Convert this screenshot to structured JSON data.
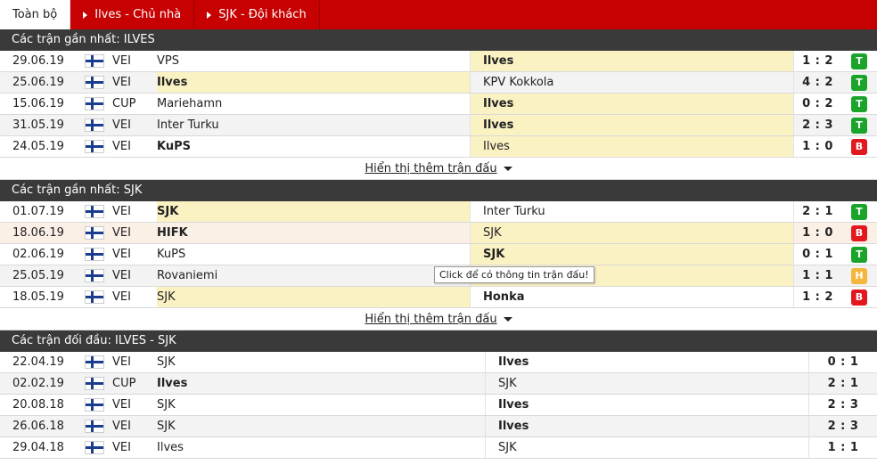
{
  "tabs": [
    {
      "label": "Toàn bộ",
      "active": true
    },
    {
      "label": "Ilves - Chủ nhà",
      "active": false
    },
    {
      "label": "SJK - Đội khách",
      "active": false
    }
  ],
  "sections": [
    {
      "title": "Các trận gần nhất: ILVES",
      "matches": [
        {
          "date": "29.06.19",
          "league": "VEI",
          "home": "VPS",
          "away": "Ilves",
          "score": "1 : 2",
          "result": "T",
          "hl": "away"
        },
        {
          "date": "25.06.19",
          "league": "VEI",
          "home": "Ilves",
          "away": "KPV Kokkola",
          "score": "4 : 2",
          "result": "T",
          "hl": "home"
        },
        {
          "date": "15.06.19",
          "league": "CUP",
          "home": "Mariehamn",
          "away": "Ilves",
          "score": "0 : 2",
          "result": "T",
          "hl": "away"
        },
        {
          "date": "31.05.19",
          "league": "VEI",
          "home": "Inter Turku",
          "away": "Ilves",
          "score": "2 : 3",
          "result": "T",
          "hl": "away"
        },
        {
          "date": "24.05.19",
          "league": "VEI",
          "home": "KuPS",
          "away": "Ilves",
          "score": "1 : 0",
          "result": "B",
          "hl": "away",
          "bold": "home"
        }
      ],
      "more": "Hiển thị thêm trận đấu"
    },
    {
      "title": "Các trận gần nhất: SJK",
      "matches": [
        {
          "date": "01.07.19",
          "league": "VEI",
          "home": "SJK",
          "away": "Inter Turku",
          "score": "2 : 1",
          "result": "T",
          "hl": "home"
        },
        {
          "date": "18.06.19",
          "league": "VEI",
          "home": "HIFK",
          "away": "SJK",
          "score": "1 : 0",
          "result": "B",
          "hl": "away",
          "bold": "home",
          "rowhl": true
        },
        {
          "date": "02.06.19",
          "league": "VEI",
          "home": "KuPS",
          "away": "SJK",
          "score": "0 : 1",
          "result": "T",
          "hl": "away"
        },
        {
          "date": "25.05.19",
          "league": "VEI",
          "home": "Rovaniemi",
          "away": "SJK",
          "score": "1 : 1",
          "result": "H",
          "hl": "away"
        },
        {
          "date": "18.05.19",
          "league": "VEI",
          "home": "SJK",
          "away": "Honka",
          "score": "1 : 2",
          "result": "B",
          "hl": "home",
          "bold": "away"
        }
      ],
      "more": "Hiển thị thêm trận đấu"
    }
  ],
  "h2h": {
    "title": "Các trận đối đầu: ILVES - SJK",
    "matches": [
      {
        "date": "22.04.19",
        "league": "VEI",
        "home": "SJK",
        "away": "Ilves",
        "score": "0 : 1",
        "bold": "away"
      },
      {
        "date": "02.02.19",
        "league": "CUP",
        "home": "Ilves",
        "away": "SJK",
        "score": "2 : 1",
        "bold": "home"
      },
      {
        "date": "20.08.18",
        "league": "VEI",
        "home": "SJK",
        "away": "Ilves",
        "score": "2 : 3",
        "bold": "away"
      },
      {
        "date": "26.06.18",
        "league": "VEI",
        "home": "SJK",
        "away": "Ilves",
        "score": "2 : 3",
        "bold": "away"
      },
      {
        "date": "29.04.18",
        "league": "VEI",
        "home": "Ilves",
        "away": "SJK",
        "score": "1 : 1",
        "bold": ""
      }
    ]
  },
  "tooltip": "Click để có thông tin trận đấu!",
  "flag_icon": "finland-flag-icon"
}
